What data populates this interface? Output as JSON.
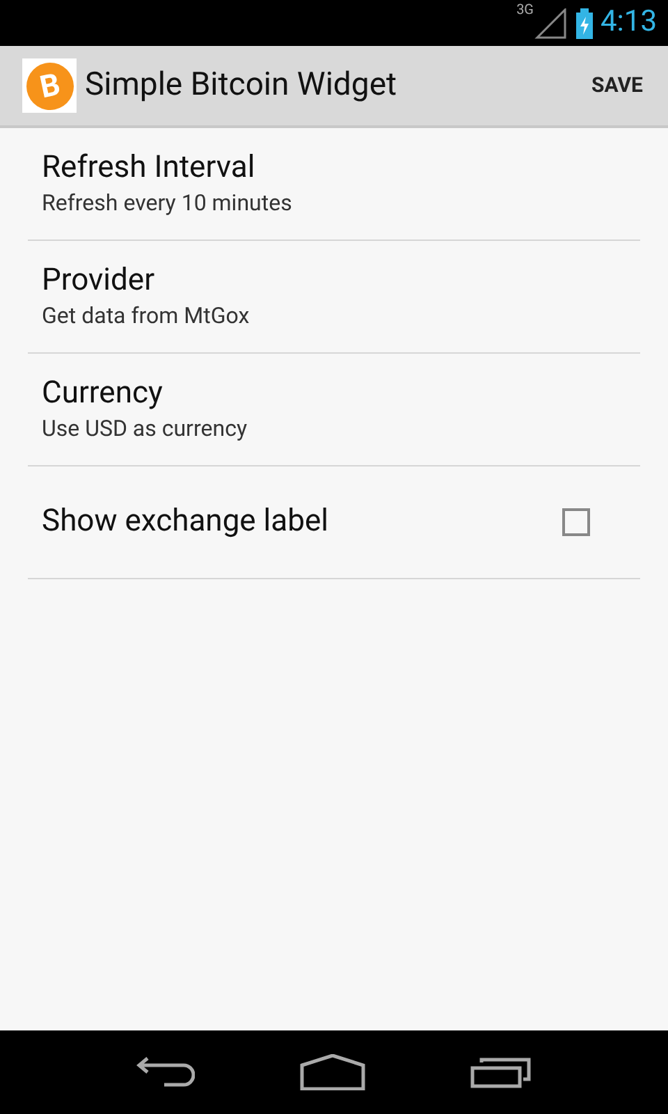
{
  "status_bar": {
    "network": "3G",
    "time": "4:13"
  },
  "action_bar": {
    "app_icon_glyph": "B",
    "title": "Simple Bitcoin Widget",
    "action": "SAVE"
  },
  "preferences": [
    {
      "kind": "text",
      "title": "Refresh Interval",
      "summary": "Refresh every 10 minutes"
    },
    {
      "kind": "text",
      "title": "Provider",
      "summary": "Get data from MtGox"
    },
    {
      "kind": "text",
      "title": "Currency",
      "summary": "Use USD as currency"
    },
    {
      "kind": "checkbox",
      "title": "Show exchange label",
      "checked": false
    }
  ]
}
